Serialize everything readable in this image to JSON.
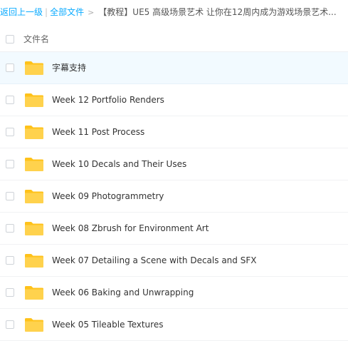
{
  "breadcrumb": {
    "back_label": "返回上一级",
    "separator": "|",
    "all_files_label": "全部文件",
    "arrow": ">",
    "current": "【教程】UE5 高级场景艺术 让你在12周内成为游戏场景艺术..."
  },
  "header": {
    "filename_label": "文件名"
  },
  "files": [
    {
      "name": "字幕支持",
      "type": "folder-icon"
    },
    {
      "name": "Week 12 Portfolio Renders",
      "type": "folder-icon"
    },
    {
      "name": "Week 11 Post Process",
      "type": "folder-icon"
    },
    {
      "name": "Week 10 Decals and Their Uses",
      "type": "folder-icon"
    },
    {
      "name": "Week 09 Photogrammetry",
      "type": "folder-icon"
    },
    {
      "name": "Week 08 Zbrush for Environment Art",
      "type": "folder-icon"
    },
    {
      "name": "Week 07 Detailing a Scene with Decals and SFX",
      "type": "folder-icon"
    },
    {
      "name": "Week 06 Baking and Unwrapping",
      "type": "folder-icon"
    },
    {
      "name": "Week 05 Tileable Textures",
      "type": "folder-icon"
    }
  ],
  "colors": {
    "link": "#09aaff",
    "folder": "#ffd24d",
    "folder_tab": "#ffc21a",
    "highlight_row": "#f2faff"
  }
}
